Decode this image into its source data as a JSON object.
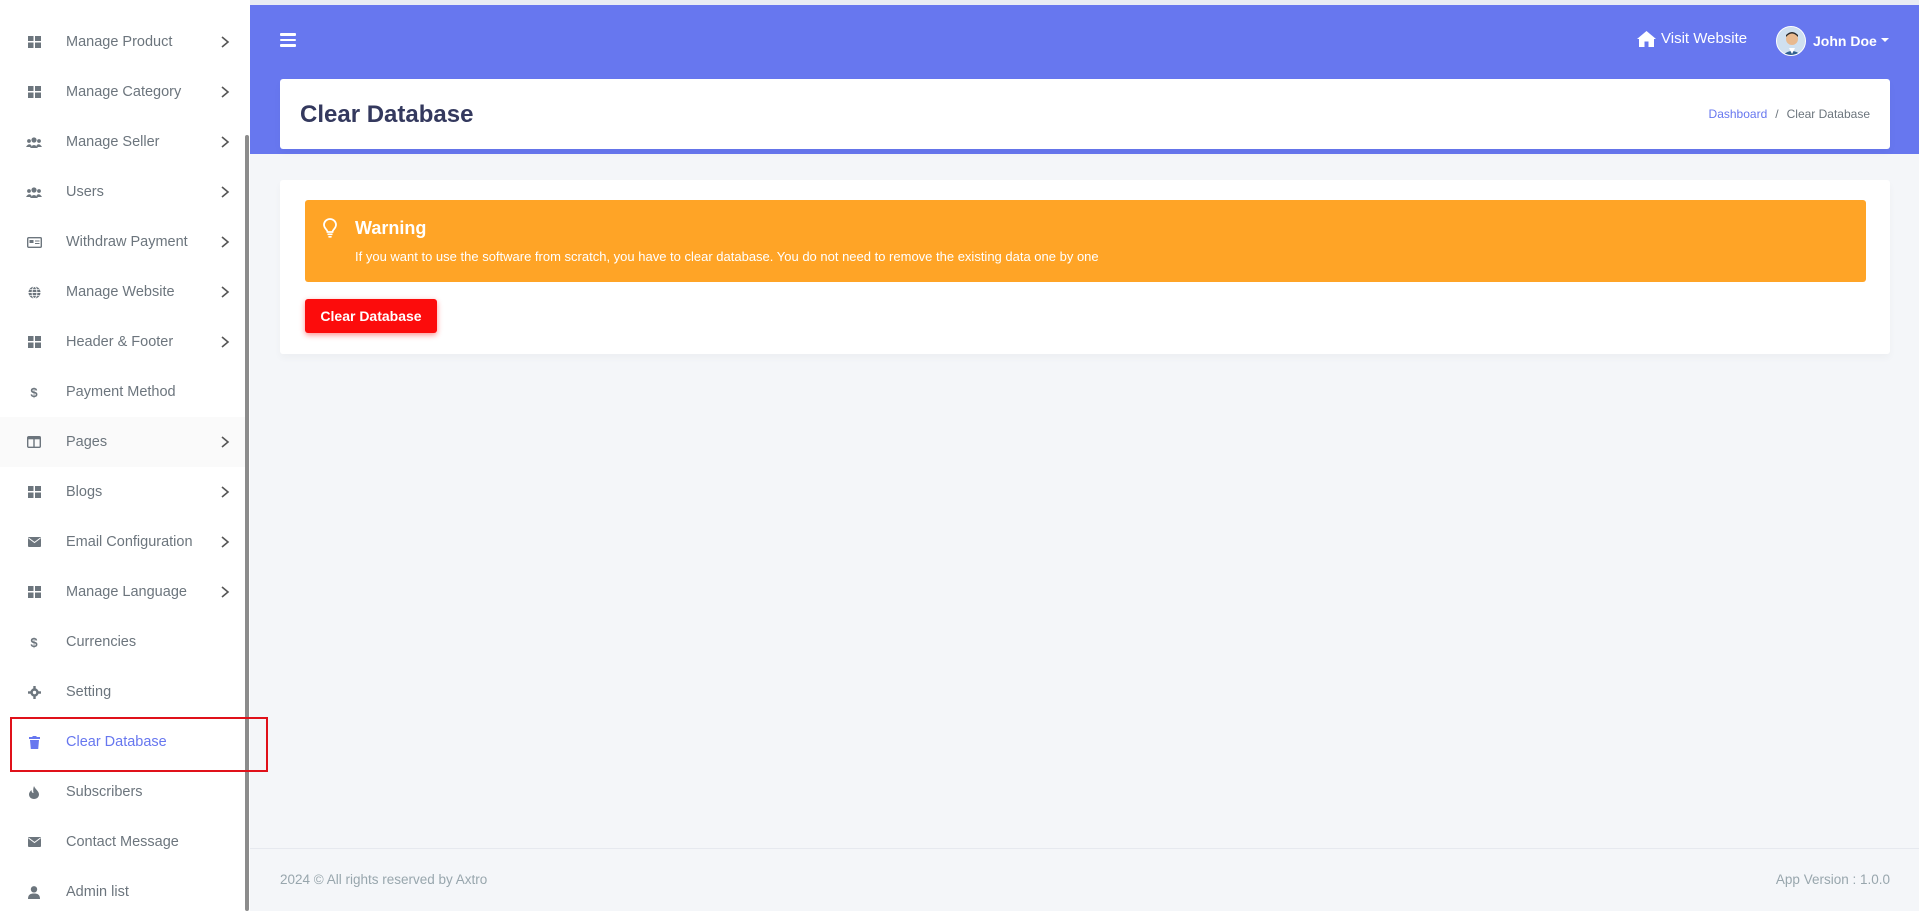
{
  "sidebar": {
    "items": [
      {
        "label": "Manage Product",
        "icon": "grid-icon",
        "has_submenu": true
      },
      {
        "label": "Manage Category",
        "icon": "grid-icon",
        "has_submenu": true
      },
      {
        "label": "Manage Seller",
        "icon": "users-icon",
        "has_submenu": true
      },
      {
        "label": "Users",
        "icon": "users-icon",
        "has_submenu": true
      },
      {
        "label": "Withdraw Payment",
        "icon": "card-icon",
        "has_submenu": true
      },
      {
        "label": "Manage Website",
        "icon": "globe-icon",
        "has_submenu": true
      },
      {
        "label": "Header & Footer",
        "icon": "grid-icon",
        "has_submenu": true
      },
      {
        "label": "Payment Method",
        "icon": "dollar-icon",
        "has_submenu": false
      },
      {
        "label": "Pages",
        "icon": "columns-icon",
        "has_submenu": true
      },
      {
        "label": "Blogs",
        "icon": "grid-icon",
        "has_submenu": true
      },
      {
        "label": "Email Configuration",
        "icon": "envelope-icon",
        "has_submenu": true
      },
      {
        "label": "Manage Language",
        "icon": "grid-icon",
        "has_submenu": true
      },
      {
        "label": "Currencies",
        "icon": "dollar-icon",
        "has_submenu": false
      },
      {
        "label": "Setting",
        "icon": "gear-icon",
        "has_submenu": false
      },
      {
        "label": "Clear Database",
        "icon": "trash-icon",
        "has_submenu": false,
        "active": true
      },
      {
        "label": "Subscribers",
        "icon": "fire-icon",
        "has_submenu": false
      },
      {
        "label": "Contact Message",
        "icon": "envelope-icon",
        "has_submenu": false
      },
      {
        "label": "Admin list",
        "icon": "user-icon",
        "has_submenu": false
      }
    ]
  },
  "header": {
    "visit_website": "Visit Website",
    "user_name": "John Doe"
  },
  "page": {
    "title": "Clear Database",
    "breadcrumb": {
      "home": "Dashboard",
      "separator": "/",
      "current": "Clear Database"
    }
  },
  "alert": {
    "title": "Warning",
    "text": "If you want to use the software from scratch, you have to clear database. You do not need to remove the existing data one by one"
  },
  "actions": {
    "clear_button": "Clear Database"
  },
  "footer": {
    "copyright": "2024 © All rights reserved by Axtro",
    "version": "App Version : 1.0.0"
  },
  "colors": {
    "primary": "#6777ef",
    "warning": "#ffa426",
    "danger": "#fc0c0c"
  }
}
